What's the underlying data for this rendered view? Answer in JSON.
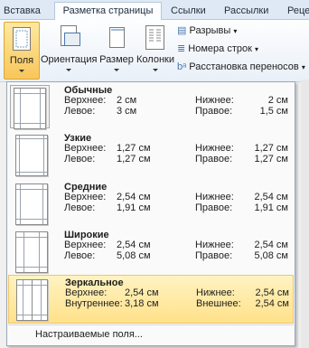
{
  "tabs": [
    "Вставка",
    "Разметка страницы",
    "Ссылки",
    "Рассылки",
    "Реце"
  ],
  "ribbon": {
    "fields": "Поля",
    "orientation": "Ориентация",
    "size": "Размер",
    "columns": "Колонки",
    "breaks": "Разрывы",
    "line_numbers": "Номера строк",
    "hyphenation": "Расстановка переносов"
  },
  "presets": [
    {
      "name": "Обычные",
      "l1": "Верхнее:",
      "v1": "2 см",
      "l2": "Левое:",
      "v2": "3 см",
      "l3": "Нижнее:",
      "v3": "2 см",
      "l4": "Правое:",
      "v4": "1,5 см"
    },
    {
      "name": "Узкие",
      "l1": "Верхнее:",
      "v1": "1,27 см",
      "l2": "Левое:",
      "v2": "1,27 см",
      "l3": "Нижнее:",
      "v3": "1,27 см",
      "l4": "Правое:",
      "v4": "1,27 см"
    },
    {
      "name": "Средние",
      "l1": "Верхнее:",
      "v1": "2,54 см",
      "l2": "Левое:",
      "v2": "1,91 см",
      "l3": "Нижнее:",
      "v3": "2,54 см",
      "l4": "Правое:",
      "v4": "1,91 см"
    },
    {
      "name": "Широкие",
      "l1": "Верхнее:",
      "v1": "2,54 см",
      "l2": "Левое:",
      "v2": "5,08 см",
      "l3": "Нижнее:",
      "v3": "2,54 см",
      "l4": "Правое:",
      "v4": "5,08 см"
    },
    {
      "name": "Зеркальное",
      "l1": "Верхнее:",
      "v1": "2,54 см",
      "l2": "Внутреннее:",
      "v2": "3,18 см",
      "l3": "Нижнее:",
      "v3": "2,54 см",
      "l4": "Внешнее:",
      "v4": "2,54 см"
    }
  ],
  "custom_fields": "Настраиваемые поля..."
}
